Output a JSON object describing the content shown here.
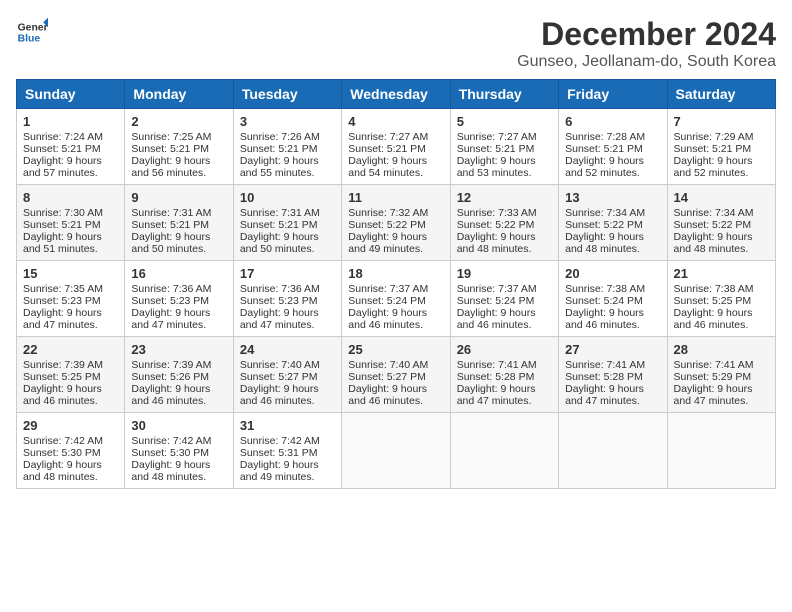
{
  "logo": {
    "line1": "General",
    "line2": "Blue"
  },
  "title": "December 2024",
  "subtitle": "Gunseo, Jeollanam-do, South Korea",
  "headers": [
    "Sunday",
    "Monday",
    "Tuesday",
    "Wednesday",
    "Thursday",
    "Friday",
    "Saturday"
  ],
  "weeks": [
    [
      {
        "day": "1",
        "rise": "Sunrise: 7:24 AM",
        "set": "Sunset: 5:21 PM",
        "daylight": "Daylight: 9 hours and 57 minutes."
      },
      {
        "day": "2",
        "rise": "Sunrise: 7:25 AM",
        "set": "Sunset: 5:21 PM",
        "daylight": "Daylight: 9 hours and 56 minutes."
      },
      {
        "day": "3",
        "rise": "Sunrise: 7:26 AM",
        "set": "Sunset: 5:21 PM",
        "daylight": "Daylight: 9 hours and 55 minutes."
      },
      {
        "day": "4",
        "rise": "Sunrise: 7:27 AM",
        "set": "Sunset: 5:21 PM",
        "daylight": "Daylight: 9 hours and 54 minutes."
      },
      {
        "day": "5",
        "rise": "Sunrise: 7:27 AM",
        "set": "Sunset: 5:21 PM",
        "daylight": "Daylight: 9 hours and 53 minutes."
      },
      {
        "day": "6",
        "rise": "Sunrise: 7:28 AM",
        "set": "Sunset: 5:21 PM",
        "daylight": "Daylight: 9 hours and 52 minutes."
      },
      {
        "day": "7",
        "rise": "Sunrise: 7:29 AM",
        "set": "Sunset: 5:21 PM",
        "daylight": "Daylight: 9 hours and 52 minutes."
      }
    ],
    [
      {
        "day": "8",
        "rise": "Sunrise: 7:30 AM",
        "set": "Sunset: 5:21 PM",
        "daylight": "Daylight: 9 hours and 51 minutes."
      },
      {
        "day": "9",
        "rise": "Sunrise: 7:31 AM",
        "set": "Sunset: 5:21 PM",
        "daylight": "Daylight: 9 hours and 50 minutes."
      },
      {
        "day": "10",
        "rise": "Sunrise: 7:31 AM",
        "set": "Sunset: 5:21 PM",
        "daylight": "Daylight: 9 hours and 50 minutes."
      },
      {
        "day": "11",
        "rise": "Sunrise: 7:32 AM",
        "set": "Sunset: 5:22 PM",
        "daylight": "Daylight: 9 hours and 49 minutes."
      },
      {
        "day": "12",
        "rise": "Sunrise: 7:33 AM",
        "set": "Sunset: 5:22 PM",
        "daylight": "Daylight: 9 hours and 48 minutes."
      },
      {
        "day": "13",
        "rise": "Sunrise: 7:34 AM",
        "set": "Sunset: 5:22 PM",
        "daylight": "Daylight: 9 hours and 48 minutes."
      },
      {
        "day": "14",
        "rise": "Sunrise: 7:34 AM",
        "set": "Sunset: 5:22 PM",
        "daylight": "Daylight: 9 hours and 48 minutes."
      }
    ],
    [
      {
        "day": "15",
        "rise": "Sunrise: 7:35 AM",
        "set": "Sunset: 5:23 PM",
        "daylight": "Daylight: 9 hours and 47 minutes."
      },
      {
        "day": "16",
        "rise": "Sunrise: 7:36 AM",
        "set": "Sunset: 5:23 PM",
        "daylight": "Daylight: 9 hours and 47 minutes."
      },
      {
        "day": "17",
        "rise": "Sunrise: 7:36 AM",
        "set": "Sunset: 5:23 PM",
        "daylight": "Daylight: 9 hours and 47 minutes."
      },
      {
        "day": "18",
        "rise": "Sunrise: 7:37 AM",
        "set": "Sunset: 5:24 PM",
        "daylight": "Daylight: 9 hours and 46 minutes."
      },
      {
        "day": "19",
        "rise": "Sunrise: 7:37 AM",
        "set": "Sunset: 5:24 PM",
        "daylight": "Daylight: 9 hours and 46 minutes."
      },
      {
        "day": "20",
        "rise": "Sunrise: 7:38 AM",
        "set": "Sunset: 5:24 PM",
        "daylight": "Daylight: 9 hours and 46 minutes."
      },
      {
        "day": "21",
        "rise": "Sunrise: 7:38 AM",
        "set": "Sunset: 5:25 PM",
        "daylight": "Daylight: 9 hours and 46 minutes."
      }
    ],
    [
      {
        "day": "22",
        "rise": "Sunrise: 7:39 AM",
        "set": "Sunset: 5:25 PM",
        "daylight": "Daylight: 9 hours and 46 minutes."
      },
      {
        "day": "23",
        "rise": "Sunrise: 7:39 AM",
        "set": "Sunset: 5:26 PM",
        "daylight": "Daylight: 9 hours and 46 minutes."
      },
      {
        "day": "24",
        "rise": "Sunrise: 7:40 AM",
        "set": "Sunset: 5:27 PM",
        "daylight": "Daylight: 9 hours and 46 minutes."
      },
      {
        "day": "25",
        "rise": "Sunrise: 7:40 AM",
        "set": "Sunset: 5:27 PM",
        "daylight": "Daylight: 9 hours and 46 minutes."
      },
      {
        "day": "26",
        "rise": "Sunrise: 7:41 AM",
        "set": "Sunset: 5:28 PM",
        "daylight": "Daylight: 9 hours and 47 minutes."
      },
      {
        "day": "27",
        "rise": "Sunrise: 7:41 AM",
        "set": "Sunset: 5:28 PM",
        "daylight": "Daylight: 9 hours and 47 minutes."
      },
      {
        "day": "28",
        "rise": "Sunrise: 7:41 AM",
        "set": "Sunset: 5:29 PM",
        "daylight": "Daylight: 9 hours and 47 minutes."
      }
    ],
    [
      {
        "day": "29",
        "rise": "Sunrise: 7:42 AM",
        "set": "Sunset: 5:30 PM",
        "daylight": "Daylight: 9 hours and 48 minutes."
      },
      {
        "day": "30",
        "rise": "Sunrise: 7:42 AM",
        "set": "Sunset: 5:30 PM",
        "daylight": "Daylight: 9 hours and 48 minutes."
      },
      {
        "day": "31",
        "rise": "Sunrise: 7:42 AM",
        "set": "Sunset: 5:31 PM",
        "daylight": "Daylight: 9 hours and 49 minutes."
      },
      null,
      null,
      null,
      null
    ]
  ]
}
